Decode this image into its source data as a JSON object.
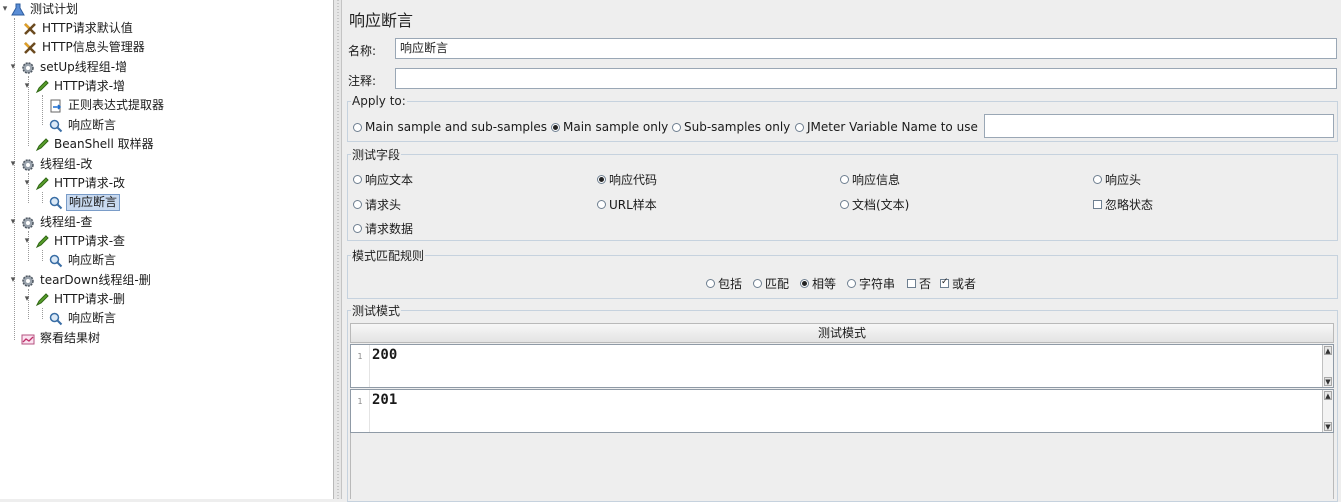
{
  "tree": {
    "items": [
      {
        "label": "测试计划",
        "icon": "flask-icon"
      },
      {
        "label": "HTTP请求默认值",
        "icon": "wrench-icon"
      },
      {
        "label": "HTTP信息头管理器",
        "icon": "wrench-icon"
      },
      {
        "label": "setUp线程组-增",
        "icon": "gear-icon"
      },
      {
        "label": "HTTP请求-增",
        "icon": "pen-icon"
      },
      {
        "label": "正则表达式提取器",
        "icon": "extractor-icon"
      },
      {
        "label": "响应断言",
        "icon": "magnifier-icon"
      },
      {
        "label": "BeanShell 取样器",
        "icon": "pen-icon"
      },
      {
        "label": "线程组-改",
        "icon": "gear-icon"
      },
      {
        "label": "HTTP请求-改",
        "icon": "pen-icon"
      },
      {
        "label": "响应断言",
        "icon": "magnifier-icon",
        "selected": true
      },
      {
        "label": "线程组-查",
        "icon": "gear-icon"
      },
      {
        "label": "HTTP请求-查",
        "icon": "pen-icon"
      },
      {
        "label": "响应断言",
        "icon": "magnifier-icon"
      },
      {
        "label": "tearDown线程组-删",
        "icon": "gear-icon"
      },
      {
        "label": "HTTP请求-删",
        "icon": "pen-icon"
      },
      {
        "label": "响应断言",
        "icon": "magnifier-icon"
      },
      {
        "label": "察看结果树",
        "icon": "chart-icon"
      }
    ]
  },
  "panel": {
    "title": "响应断言",
    "name_label": "名称:",
    "name_value": "响应断言",
    "comment_label": "注释:",
    "comment_value": "",
    "apply_to": {
      "legend": "Apply to:",
      "options": [
        "Main sample and sub-samples",
        "Main sample only",
        "Sub-samples only",
        "JMeter Variable Name to use"
      ],
      "selected": "Main sample only",
      "variable_value": ""
    },
    "test_field": {
      "legend": "测试字段",
      "options": [
        "响应文本",
        "响应代码",
        "响应信息",
        "响应头",
        "请求头",
        "URL样本",
        "文档(文本)",
        "请求数据"
      ],
      "ignore_status": "忽略状态",
      "ignore_status_checked": false,
      "selected": "响应代码"
    },
    "pattern_rules": {
      "legend": "模式匹配规则",
      "options": [
        "包括",
        "匹配",
        "相等",
        "字符串"
      ],
      "selected": "相等",
      "not_label": "否",
      "not_checked": false,
      "or_label": "或者",
      "or_checked": true
    },
    "patterns": {
      "legend": "测试模式",
      "column_header": "测试模式",
      "rows": [
        {
          "line": "1",
          "value": "200"
        },
        {
          "line": "1",
          "value": "201"
        }
      ]
    }
  }
}
